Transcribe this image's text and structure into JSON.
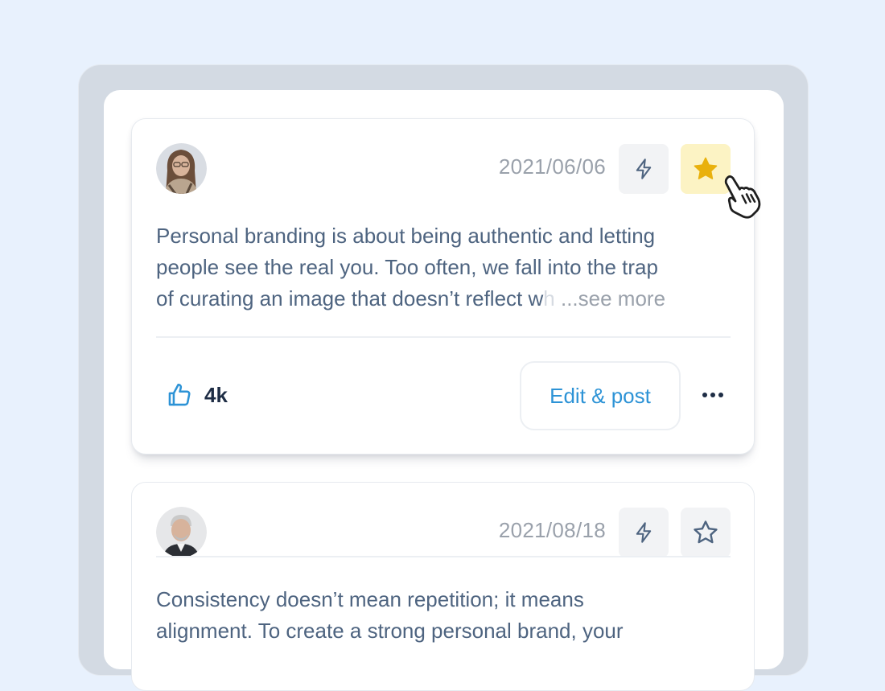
{
  "posts": [
    {
      "date": "2021/06/06",
      "text_lines": [
        "Personal branding is about being authentic and letting",
        "people see the real you. Too often, we fall into the trap",
        "of curating an image that doesn’t reflect w"
      ],
      "text_faded": "h",
      "see_more": "...see more",
      "likes": "4k",
      "edit_label": "Edit & post",
      "more_label": "•••",
      "starred": true,
      "icons": {
        "avatar": "woman-avatar",
        "bolt": "lightning-icon",
        "star": "star-icon-filled",
        "like": "thumbs-up-icon",
        "cursor": "hand-pointer-cursor"
      }
    },
    {
      "date": "2021/08/18",
      "text_lines": [
        "Consistency doesn’t mean repetition; it means",
        "alignment. To create a strong personal brand, your"
      ],
      "starred": false,
      "icons": {
        "avatar": "man-avatar",
        "bolt": "lightning-icon",
        "star": "star-icon-outline"
      }
    }
  ],
  "colors": {
    "background": "#e8f1fd",
    "accent": "#2d93d6",
    "star_active": "#e9b10d",
    "star_active_bg": "#fcf3c4"
  }
}
